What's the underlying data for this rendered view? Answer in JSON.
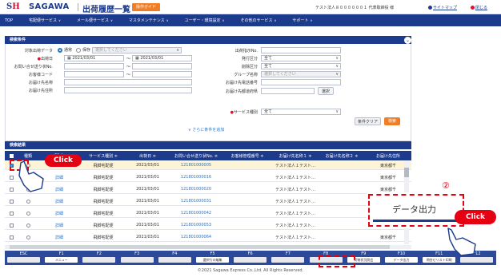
{
  "header": {
    "logo": "S",
    "logo_h": "H",
    "brand": "SAGAWA",
    "title": "出荷履歴一覧",
    "guide": "操作ガイド",
    "account": "テスト法人８００００００１ 代表取締役 様",
    "sitemap": "サイトマップ",
    "close": "閉じる"
  },
  "nav": [
    {
      "label": "TOP"
    },
    {
      "label": "宅配便サービス",
      "caret": "∨"
    },
    {
      "label": "メール便サービス",
      "caret": "∨"
    },
    {
      "label": "マスタメンテナンス",
      "caret": "∨"
    },
    {
      "label": "ユーザー・環境設定",
      "caret": "∨"
    },
    {
      "label": "その他のサービス",
      "caret": "∨"
    },
    {
      "label": "サポート",
      "caret": "∨"
    }
  ],
  "search": {
    "section": "検索条件",
    "target_label": "対象出荷データ",
    "opt_normal": "通常",
    "opt_save": "保存",
    "opt_save_sel": "選択してください",
    "date_label": "出荷日",
    "date_from": "2021/03/01",
    "date_to": "2021/03/01",
    "tilde": "～",
    "inquiry_label": "お問い合せ送り状No.",
    "customer_code_label": "お客様コード",
    "customer_name_label": "お届け先名称",
    "customer_addr_label": "お届け先住所",
    "manifest_label": "出荷指示No.",
    "print_label": "発行区分",
    "print_val": "全て",
    "delete_label": "削除区分",
    "delete_val": "全て",
    "group_label": "グループ名称",
    "group_val": "選択してください",
    "phone_label": "お届け先電話番号",
    "area_label": "お届け先都道府県",
    "select_btn": "選択",
    "service_label": "サービス種別",
    "service_val": "全て",
    "more": "さらに条件を追加",
    "clear_btn": "条件クリア",
    "search_btn": "検索"
  },
  "results": {
    "section": "検索結果",
    "columns": [
      "",
      "種類",
      "Click",
      "サービス種別 ≑",
      "出荷日 ≑",
      "お問い合せ送り状No. ≑",
      "お客様管理番号 ≑",
      "お届け先名称１ ≑",
      "お届け先名称２ ≑",
      "お届け先住所"
    ],
    "rows": [
      {
        "detail": "",
        "service": "飛脚宅配便",
        "date": "2021/03/01",
        "no": "121801000005",
        "name1": "テスト法人１テスト…",
        "addr": "東京都千"
      },
      {
        "detail": "詳細",
        "service": "飛脚宅配便",
        "date": "2021/03/01",
        "no": "121801000016",
        "name1": "テスト法人１テスト…",
        "addr": "東京都千"
      },
      {
        "detail": "詳細",
        "service": "飛脚宅配便",
        "date": "2021/03/01",
        "no": "121801000020",
        "name1": "テスト法人１テスト…",
        "addr": "東京都千"
      },
      {
        "detail": "詳細",
        "service": "飛脚宅配便",
        "date": "2021/03/01",
        "no": "121801000031",
        "name1": "テスト法人１テスト…",
        "addr": "東京都千"
      },
      {
        "detail": "詳細",
        "service": "飛脚宅配便",
        "date": "2021/03/01",
        "no": "121801000042",
        "name1": "テスト法人１テスト…",
        "addr": "東京都千"
      },
      {
        "detail": "詳細",
        "service": "飛脚宅配便",
        "date": "2021/03/01",
        "no": "121801000053",
        "name1": "テスト法人１テスト…",
        "addr": "東京都千"
      },
      {
        "detail": "詳細",
        "service": "飛脚宅配便",
        "date": "2021/03/01",
        "no": "121801000064",
        "name1": "テスト法人１テスト…",
        "addr": "東京都千"
      }
    ]
  },
  "fkeys": [
    {
      "key": "ESC",
      "btn": ""
    },
    {
      "key": "F1",
      "btn": "メニュー"
    },
    {
      "key": "F2",
      "btn": ""
    },
    {
      "key": "F3",
      "btn": ""
    },
    {
      "key": "F4",
      "btn": ""
    },
    {
      "key": "F5",
      "btn": "選択行の編集"
    },
    {
      "key": "F6",
      "btn": ""
    },
    {
      "key": "F7",
      "btn": ""
    },
    {
      "key": "F8",
      "btn": ""
    },
    {
      "key": "F9",
      "btn": "荷物状況照会"
    },
    {
      "key": "F10",
      "btn": "データ出力"
    },
    {
      "key": "F11",
      "btn": "問合せリスト印刷"
    },
    {
      "key": "F12",
      "btn": ""
    }
  ],
  "copyright": "©2021 Sagawa Express Co.,Ltd. All Rights Reserved.",
  "overlay": {
    "click": "Click",
    "step": "②",
    "popup": "データ出力"
  },
  "colors": {
    "navy": "#1d3b8c",
    "orange": "#f07e26",
    "red": "#e50012"
  }
}
